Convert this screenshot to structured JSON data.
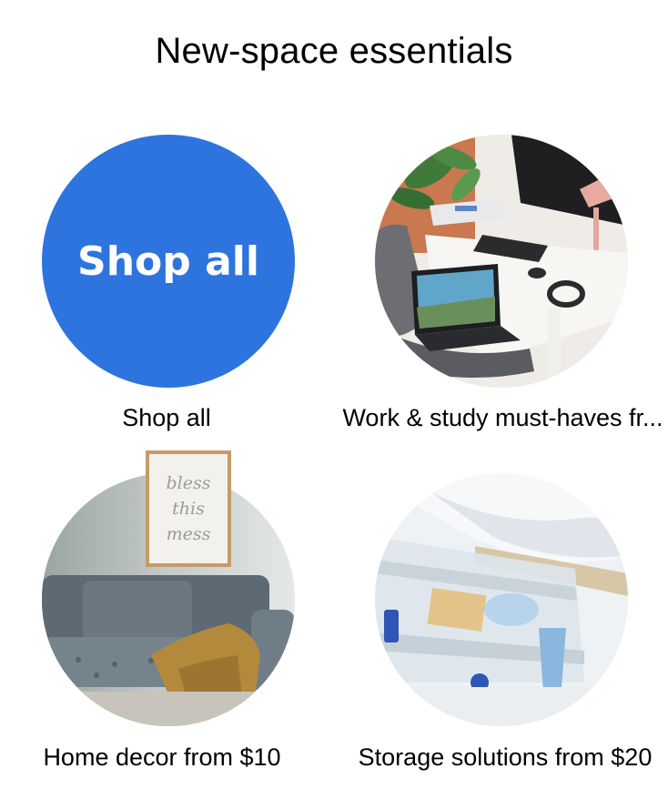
{
  "title": "New-space essentials",
  "tiles": [
    {
      "label": "Shop all",
      "circle_text": "Shop all",
      "circle_color": "#2e74de",
      "image": "shop-all-badge"
    },
    {
      "label": "Work & study must-haves fr...",
      "image": "desk-workspace-photo"
    },
    {
      "label": "Home decor from $10",
      "image": "sofa-living-room-photo",
      "frame_text": [
        "bless",
        "this",
        "mess"
      ]
    },
    {
      "label": "Storage solutions from $20",
      "image": "underbed-storage-bins-photo"
    }
  ]
}
